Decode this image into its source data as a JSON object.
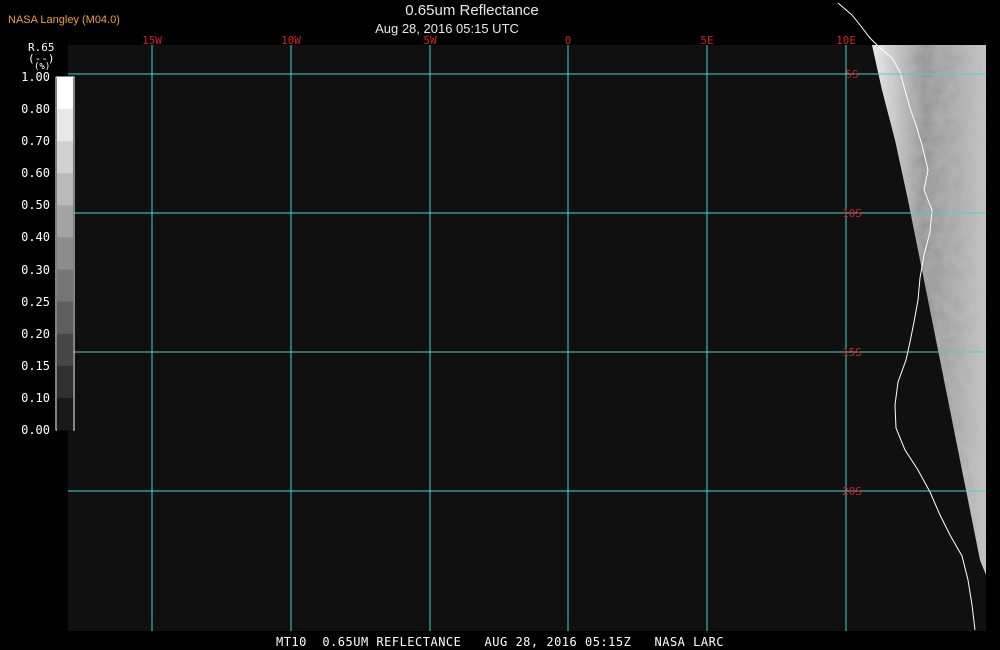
{
  "header": {
    "producer": "NASA Langley (M04.0)",
    "title": "0.65um Reflectance",
    "datetime": "Aug 28, 2016 05:15 UTC"
  },
  "colorbar": {
    "var_name": "R.65",
    "units_line1": "(--)",
    "units_line2": "(%)",
    "labels": [
      "1.00",
      "0.80",
      "0.70",
      "0.60",
      "0.50",
      "0.40",
      "0.30",
      "0.25",
      "0.20",
      "0.15",
      "0.10",
      "0.00"
    ]
  },
  "map": {
    "longitude_labels": [
      "15W",
      "10W",
      "5W",
      "0",
      "5E",
      "10E"
    ],
    "latitude_labels": [
      "5S",
      "10S",
      "15S",
      "20S"
    ],
    "grid_color": "#3fd4d4",
    "label_color": "#d02020"
  },
  "footer": {
    "text": "MT10  0.65UM REFLECTANCE   AUG 28, 2016 05:15Z   NASA LARC"
  }
}
